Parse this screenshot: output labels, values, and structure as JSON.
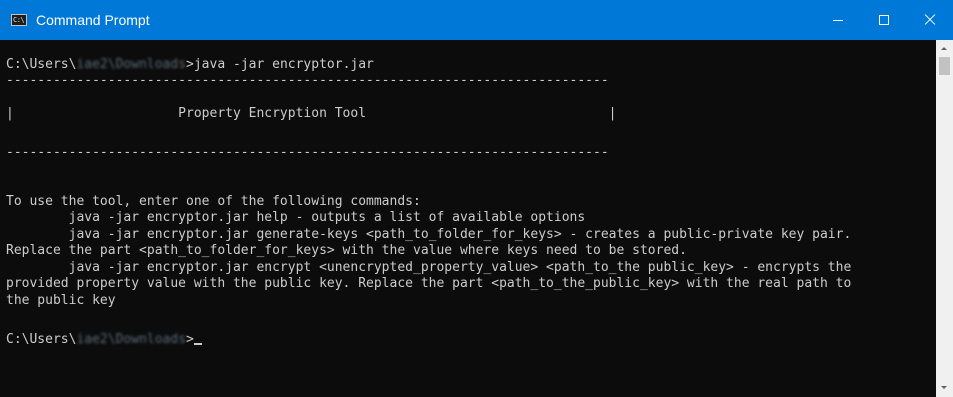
{
  "window": {
    "title": "Command Prompt",
    "icon": "cmd-icon",
    "icon_text": "C:\\",
    "controls": {
      "minimize": "minimize-icon",
      "maximize": "maximize-icon",
      "close": "close-icon"
    },
    "titlebar_color": "#0078d7",
    "console_background": "#0c0c0c",
    "console_text_color": "#cccccc"
  },
  "console": {
    "prompt1": {
      "prefix": "C:\\Users\\",
      "redacted": "iae2\\Downloads",
      "command": ">java -jar encryptor.jar"
    },
    "lines": [
      "-----------------------------------------------------------------------------",
      "",
      "|                     Property Encryption Tool                               |",
      "",
      "-----------------------------------------------------------------------------",
      "",
      "",
      "To use the tool, enter one of the following commands:",
      "        java -jar encryptor.jar help - outputs a list of available options",
      "        java -jar encryptor.jar generate-keys <path_to_folder_for_keys> - creates a public-private key pair.",
      "Replace the part <path_to_folder_for_keys> with the value where keys need to be stored.",
      "        java -jar encryptor.jar encrypt <unencrypted_property_value> <path_to_the public_key> - encrypts the",
      "provided property value with the public key. Replace the part <path_to_the_public_key> with the real path to",
      "the public key",
      ""
    ],
    "prompt2": {
      "prefix": "C:\\Users\\",
      "redacted": "iae2\\Downloads",
      "suffix": ">"
    }
  }
}
